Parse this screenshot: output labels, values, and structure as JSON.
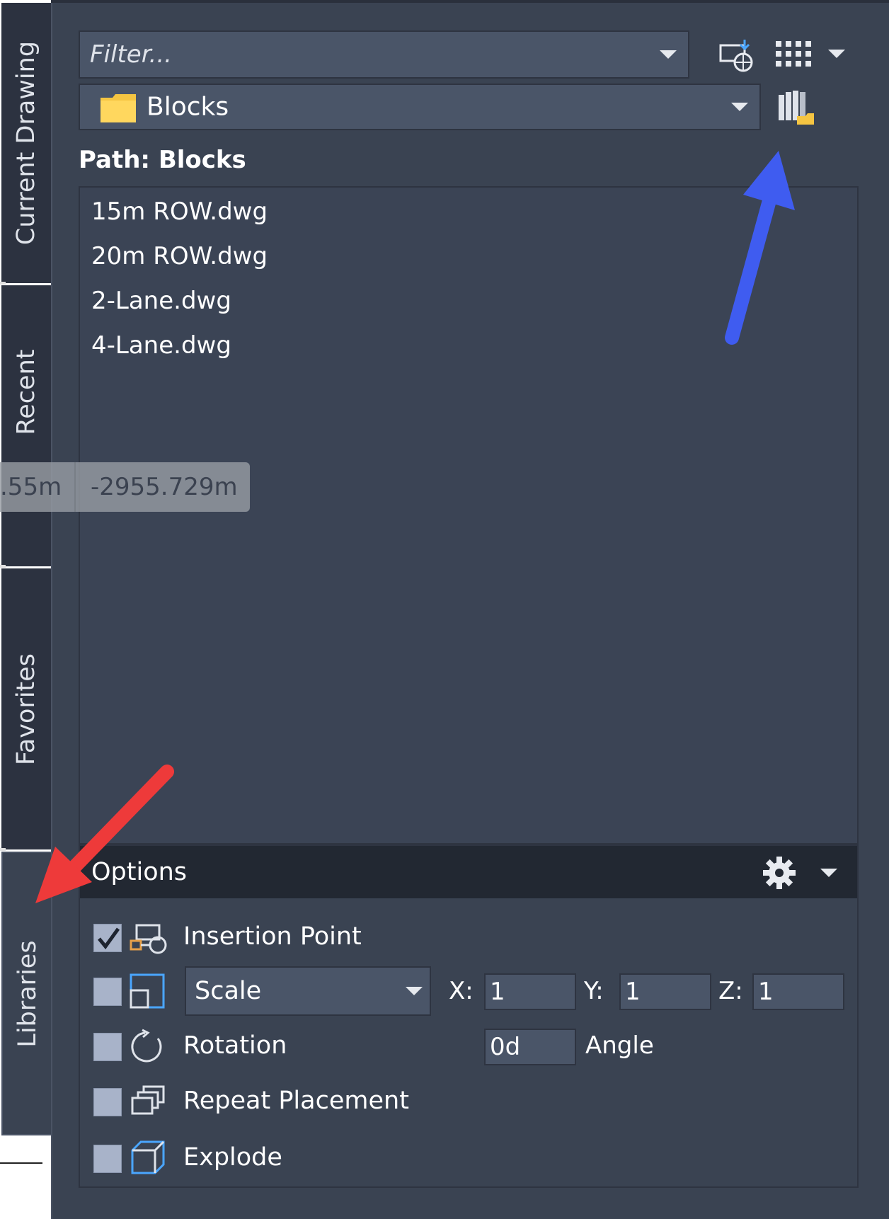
{
  "tabs": [
    {
      "label": "Current Drawing",
      "active": false
    },
    {
      "label": "Recent",
      "active": false
    },
    {
      "label": "Favorites",
      "active": false
    },
    {
      "label": "Libraries",
      "active": true
    }
  ],
  "toolbar": {
    "filter_placeholder": "Filter...",
    "library_selected": "Blocks",
    "icons": [
      "insert-block-icon",
      "grid-view-icon",
      "view-dropdown-icon",
      "browse-library-icon"
    ]
  },
  "path_label": "Path: Blocks",
  "files": [
    "15m ROW.dwg",
    "20m ROW.dwg",
    "2-Lane.dwg",
    "4-Lane.dwg"
  ],
  "tooltip": {
    "left_value": ".55m",
    "right_value": "-2955.729m"
  },
  "options": {
    "title": "Options",
    "rows": {
      "insertion_point": {
        "label": "Insertion Point",
        "checked": true
      },
      "scale": {
        "mode": "Scale",
        "checked": false,
        "x_label": "X:",
        "x": "1",
        "y_label": "Y:",
        "y": "1",
        "z_label": "Z:",
        "z": "1"
      },
      "rotation": {
        "label": "Rotation",
        "checked": false,
        "value": "0d",
        "unit_label": "Angle"
      },
      "repeat": {
        "label": "Repeat Placement",
        "checked": false
      },
      "explode": {
        "label": "Explode",
        "checked": false
      }
    }
  },
  "colors": {
    "panel": "#3a4352",
    "field": "#4a5568",
    "header": "#222832",
    "blue_arrow": "#3f5cf0",
    "red_arrow": "#ee3a3a",
    "folder": "#f5c542"
  }
}
